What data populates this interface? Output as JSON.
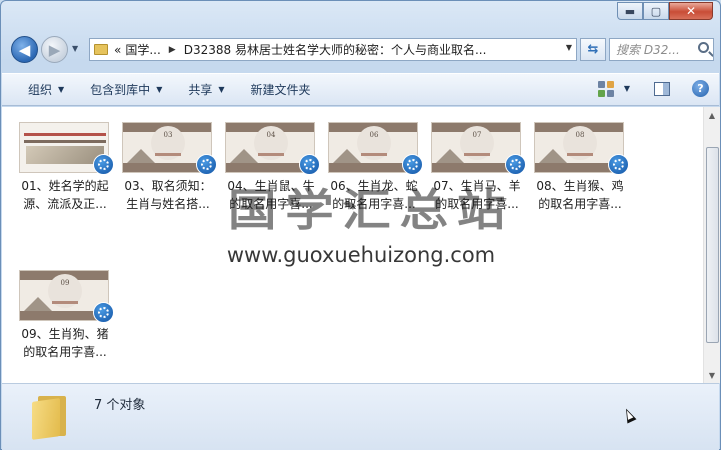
{
  "window": {
    "caption": {
      "minimize": "▬",
      "maximize": "▢",
      "close": "✕"
    }
  },
  "nav": {
    "back_icon": "arrow-left-icon",
    "forward_icon": "arrow-right-icon",
    "breadcrumb": [
      "国学...",
      "D32388 易林居士姓名学大师的秘密：个人与商业取名..."
    ],
    "breadcrumb_prefix": "«",
    "search_placeholder": "搜索 D32..."
  },
  "toolbar": {
    "organize": "组织",
    "include_library": "包含到库中",
    "share": "共享",
    "new_folder": "新建文件夹"
  },
  "files": [
    {
      "line1": "01、姓名学的起",
      "line2": "源、流派及正...",
      "thumb_num": "",
      "style": "cover"
    },
    {
      "line1": "03、取名须知：",
      "line2": "生肖与姓名搭...",
      "thumb_num": "03",
      "style": "slide"
    },
    {
      "line1": "04、生肖鼠、牛",
      "line2": "的取名用字喜...",
      "thumb_num": "04",
      "style": "slide"
    },
    {
      "line1": "06、生肖龙、蛇",
      "line2": "的取名用字喜...",
      "thumb_num": "06",
      "style": "slide"
    },
    {
      "line1": "07、生肖马、羊",
      "line2": "的取名用字喜...",
      "thumb_num": "07",
      "style": "slide"
    },
    {
      "line1": "08、生肖猴、鸡",
      "line2": "的取名用字喜...",
      "thumb_num": "08",
      "style": "slide"
    },
    {
      "line1": "09、生肖狗、猪",
      "line2": "的取名用字喜...",
      "thumb_num": "09",
      "style": "slide"
    }
  ],
  "watermark": {
    "text": "国学汇总站",
    "url": "www.guoxuehuizong.com"
  },
  "status": {
    "count": "7 个对象"
  }
}
